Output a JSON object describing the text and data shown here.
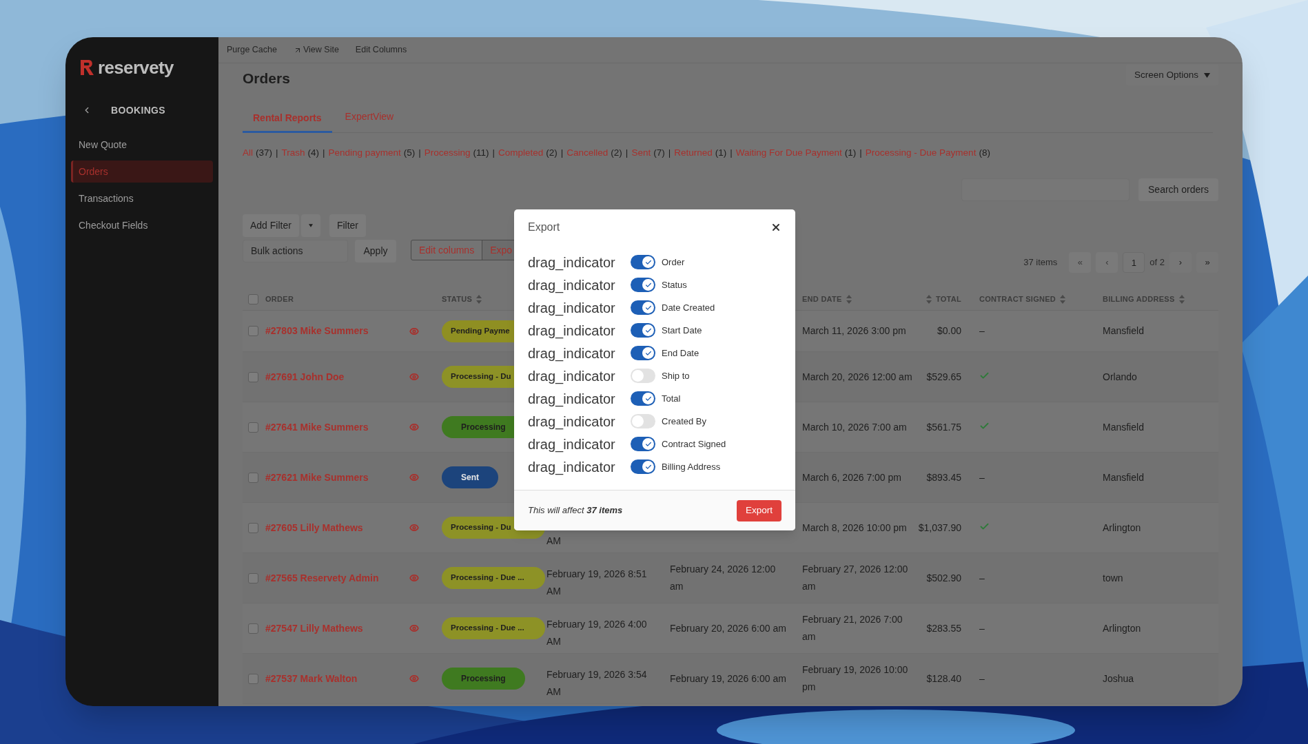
{
  "sidebar": {
    "logo": "reservety",
    "section": "BOOKINGS",
    "items": [
      {
        "label": "New Quote",
        "selected": false
      },
      {
        "label": "Orders",
        "selected": true
      },
      {
        "label": "Transactions",
        "selected": false
      },
      {
        "label": "Checkout Fields",
        "selected": false
      }
    ]
  },
  "topbar": {
    "links": [
      {
        "label": "Purge Cache",
        "external": false
      },
      {
        "label": "View Site",
        "external": true
      },
      {
        "label": "Edit Columns",
        "external": false
      }
    ]
  },
  "page_title": "Orders",
  "screen_options": "Screen Options",
  "tabs": [
    {
      "label": "Rental Reports",
      "selected": true
    },
    {
      "label": "ExpertView",
      "selected": false
    }
  ],
  "status_filters": [
    {
      "label": "All",
      "count": "(37)",
      "separator": "|"
    },
    {
      "label": "Trash",
      "count": "(4)",
      "separator": "|"
    },
    {
      "label": "Pending payment",
      "count": "(5)",
      "separator": "|"
    },
    {
      "label": "Processing",
      "count": "(11)",
      "separator": "|"
    },
    {
      "label": "Completed",
      "count": "(2)",
      "separator": "|"
    },
    {
      "label": "Cancelled",
      "count": "(2)",
      "separator": "|"
    },
    {
      "label": "Sent",
      "count": "(7)",
      "separator": "|"
    },
    {
      "label": "Returned",
      "count": "(1)",
      "separator": "|"
    },
    {
      "label": "Waiting For Due Payment",
      "count": "(1)",
      "separator": "|"
    },
    {
      "label": "Processing - Due Payment",
      "count": "(8)"
    }
  ],
  "search": {
    "button": "Search orders"
  },
  "toolbar": {
    "add_filter": "Add Filter",
    "filter": "Filter",
    "bulk_actions": "Bulk actions",
    "apply": "Apply",
    "edit_columns": "Edit columns",
    "export": "Expo"
  },
  "pagination": {
    "items": "37 items",
    "first": "«",
    "prev": "‹",
    "page": "1",
    "of": "of 2",
    "next": "›",
    "last": "»"
  },
  "table": {
    "select_all_checked": false,
    "columns": [
      {
        "label": "ORDER",
        "sortable": false
      },
      {
        "label": "STATUS",
        "sortable": true
      },
      {
        "label": "END DATE",
        "sortable": true
      },
      {
        "label": "TOTAL",
        "sortable": true
      },
      {
        "label": "CONTRACT SIGNED",
        "sortable": true
      },
      {
        "label": "BILLING ADDRESS",
        "sortable": true
      }
    ],
    "rows": [
      {
        "checked": false,
        "order": "#27803 Mike Summers",
        "status": {
          "label": "Pending Payme",
          "kind": "pending"
        },
        "end_date": "March 11, 2026 3:00 pm",
        "total": "$0.00",
        "contract": {
          "signed": false,
          "text": "–"
        },
        "billing": "Mansfield"
      },
      {
        "checked": false,
        "order": "#27691 John Doe",
        "status": {
          "label": "Processing - Du",
          "kind": "due"
        },
        "end_date": "March 20, 2026 12:00 am",
        "total": "$529.65",
        "contract": {
          "signed": true
        },
        "billing": "Orlando"
      },
      {
        "checked": false,
        "order": "#27641 Mike Summers",
        "status": {
          "label": "Processing",
          "kind": "processing"
        },
        "end_date": "March 10, 2026 7:00 am",
        "total": "$561.75",
        "contract": {
          "signed": true
        },
        "billing": "Mansfield"
      },
      {
        "checked": false,
        "order": "#27621 Mike Summers",
        "status": {
          "label": "Sent",
          "kind": "sent"
        },
        "end_date": "March 6, 2026 7:00 pm",
        "total": "$893.45",
        "contract": {
          "signed": false,
          "text": "–"
        },
        "billing": "Mansfield"
      },
      {
        "checked": false,
        "order": "#27605 Lilly Mathews",
        "status": {
          "label": "Processing - Du",
          "kind": "due"
        },
        "date_created": "AM",
        "end_date": "March 8, 2026 10:00 pm",
        "total": "$1,037.90",
        "contract": {
          "signed": true
        },
        "billing": "Arlington"
      },
      {
        "checked": false,
        "order": "#27565 Reservety Admin",
        "status": {
          "label": "Processing - Due ...",
          "kind": "due"
        },
        "date_created": "February 19, 2026 8:51 AM",
        "start_date": "February 24, 2026 12:00 am",
        "end_date": "February 27, 2026 12:00 am",
        "total": "$502.90",
        "contract": {
          "signed": false,
          "text": "–"
        },
        "billing": "town"
      },
      {
        "checked": false,
        "order": "#27547 Lilly Mathews",
        "status": {
          "label": "Processing - Due ...",
          "kind": "due"
        },
        "date_created": "February 19, 2026 4:00 AM",
        "start_date": "February 20, 2026 6:00 am",
        "end_date": "February 21, 2026 7:00 am",
        "total": "$283.55",
        "contract": {
          "signed": false,
          "text": "–"
        },
        "billing": "Arlington"
      },
      {
        "checked": false,
        "order": "#27537 Mark Walton",
        "status": {
          "label": "Processing",
          "kind": "processing"
        },
        "date_created": "February 19, 2026 3:54 AM",
        "start_date": "February 19, 2026 6:00 am",
        "end_date": "February 19, 2026 10:00 pm",
        "total": "$128.40",
        "contract": {
          "signed": false,
          "text": "–"
        },
        "billing": "Joshua"
      }
    ]
  },
  "modal": {
    "title": "Export",
    "columns": [
      {
        "handle": "drag_indicator",
        "label": "Order",
        "on": true
      },
      {
        "handle": "drag_indicator",
        "label": "Status",
        "on": true
      },
      {
        "handle": "drag_indicator",
        "label": "Date Created",
        "on": true
      },
      {
        "handle": "drag_indicator",
        "label": "Start Date",
        "on": true
      },
      {
        "handle": "drag_indicator",
        "label": "End Date",
        "on": true
      },
      {
        "handle": "drag_indicator",
        "label": "Ship to",
        "on": false
      },
      {
        "handle": "drag_indicator",
        "label": "Total",
        "on": true
      },
      {
        "handle": "drag_indicator",
        "label": "Created By",
        "on": false
      },
      {
        "handle": "drag_indicator",
        "label": "Contract Signed",
        "on": true
      },
      {
        "handle": "drag_indicator",
        "label": "Billing Address",
        "on": true
      }
    ],
    "note": "This will affect **37 items**",
    "button": "Export"
  }
}
